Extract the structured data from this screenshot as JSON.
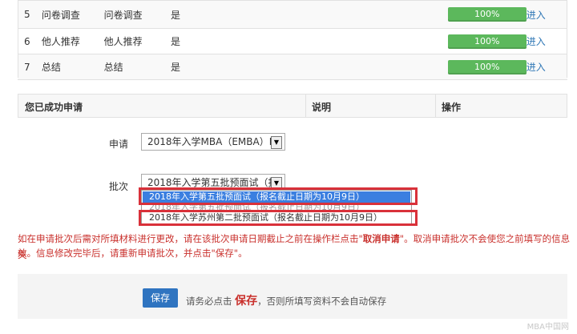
{
  "steps": [
    {
      "no": "5",
      "name": "问卷调查",
      "name2": "问卷调查",
      "required": "是",
      "progress": "100%",
      "action": "进入"
    },
    {
      "no": "6",
      "name": "他人推荐",
      "name2": "他人推荐",
      "required": "是",
      "progress": "100%",
      "action": "进入"
    },
    {
      "no": "7",
      "name": "总结",
      "name2": "总结",
      "required": "是",
      "progress": "100%",
      "action": "进入"
    }
  ],
  "submitted": {
    "col1": "您已成功申请",
    "col2": "说明",
    "col3": "操作"
  },
  "form": {
    "apply_label": "申请",
    "apply_value": "2018年入学MBA（EMBA）I",
    "batch_label": "批次",
    "batch_value": "2018年入学第五批预面试（报",
    "options": [
      "2018年入学第五批预面试（报名截止日期为10月9日）",
      "2018年入学第五批预面试（报名截止日期为10月9日）",
      "2018年入学苏州第二批预面试（报名截止日期为10月9日）"
    ]
  },
  "note": {
    "line1a": "如在申请批次后需对所填材料进行更改，请在该批次申请日期截止之前在操作栏点击\"",
    "line1b": "取消申请",
    "line1c": "\"。取消申请批次不会使您之前填写的信息失",
    "line2": "效。信息修改完毕后，请重新申请批次，并点击\"保存\"。"
  },
  "save": {
    "button": "保存",
    "pre": "请务必点击",
    "bold": "保存",
    "post": "，否则所填写资料不会自动保存"
  },
  "watermark": "MBA中国网"
}
